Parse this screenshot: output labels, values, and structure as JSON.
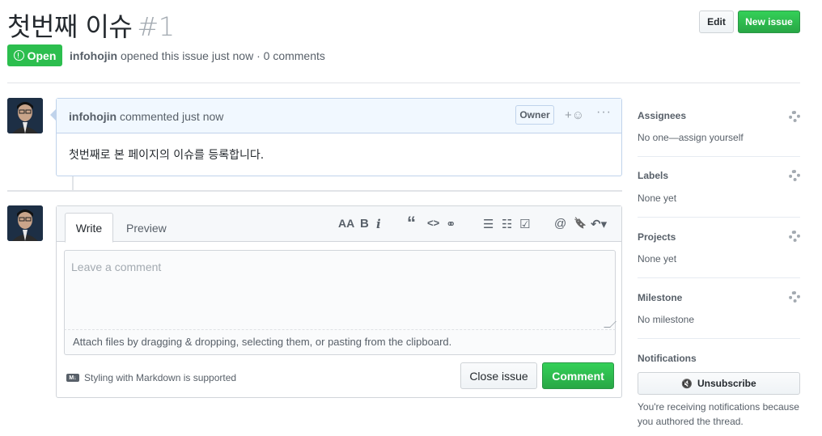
{
  "issue": {
    "title": "첫번째 이슈",
    "number": "#1",
    "state": "Open",
    "author": "infohojin",
    "meta_text": "opened this issue just now · 0 comments"
  },
  "header_buttons": {
    "edit": "Edit",
    "new_issue": "New issue"
  },
  "comment": {
    "author": "infohojin",
    "action": "commented just now",
    "badge": "Owner",
    "reaction": "+☺",
    "more": "···",
    "body": "첫번째로 본 페이지의 이슈를 등록합니다."
  },
  "editor": {
    "tabs": [
      "Write",
      "Preview"
    ],
    "placeholder": "Leave a comment",
    "attach_text": "Attach files by dragging & dropping, selecting them, or pasting from the clipboard.",
    "markdown_note": "Styling with Markdown is supported",
    "markdown_icon": "M↓",
    "close_button": "Close issue",
    "comment_button": "Comment",
    "toolbar": {
      "heading": "AA",
      "bold": "B",
      "italic": "i",
      "quote": "“",
      "code": "<>",
      "link": "⚭",
      "ul": "☰",
      "ol": "☷",
      "tasklist": "☑",
      "mention": "@",
      "bookmark": "🔖",
      "reply": "↶▾"
    }
  },
  "sidebar": {
    "assignees": {
      "label": "Assignees",
      "value": "No one—assign yourself"
    },
    "labels": {
      "label": "Labels",
      "value": "None yet"
    },
    "projects": {
      "label": "Projects",
      "value": "None yet"
    },
    "milestone": {
      "label": "Milestone",
      "value": "No milestone"
    },
    "notifications": {
      "label": "Notifications",
      "button": "Unsubscribe",
      "button_icon": "🔇",
      "text": "You're receiving notifications because you authored the thread."
    }
  },
  "colors": {
    "green": "#2cbe4e",
    "blue_border": "#c0d3eb",
    "head_bg": "#f1f8ff"
  }
}
